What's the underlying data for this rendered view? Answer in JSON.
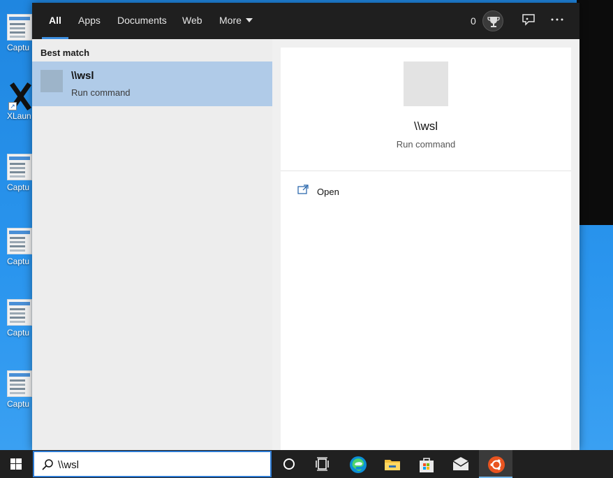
{
  "desktop": {
    "icons": [
      {
        "label": "Captu"
      },
      {
        "label": "XLaun"
      },
      {
        "label": "Captu"
      },
      {
        "label": "Captu"
      },
      {
        "label": "Captu"
      },
      {
        "label": "Captu"
      }
    ]
  },
  "search": {
    "tabs": [
      {
        "label": "All",
        "active": true
      },
      {
        "label": "Apps"
      },
      {
        "label": "Documents"
      },
      {
        "label": "Web"
      },
      {
        "label": "More"
      }
    ],
    "points": "0",
    "best_match_heading": "Best match",
    "result": {
      "title": "\\\\wsl",
      "subtitle": "Run command"
    },
    "detail": {
      "title": "\\\\wsl",
      "subtitle": "Run command",
      "actions": [
        {
          "label": "Open",
          "icon": "open-icon"
        }
      ]
    },
    "query": "\\\\wsl"
  },
  "taskbar": {
    "items": [
      "windows-logo-icon",
      "cortana-icon",
      "task-view-icon",
      "edge-icon",
      "file-explorer-icon",
      "store-icon",
      "mail-icon",
      "ubuntu-icon"
    ]
  },
  "colors": {
    "tabbar_bg": "#1f1f1f",
    "accent": "#3d8fe0",
    "selected_result": "#b0cbe8",
    "taskbar_bg": "#202020",
    "ubuntu_orange": "#e95420"
  }
}
